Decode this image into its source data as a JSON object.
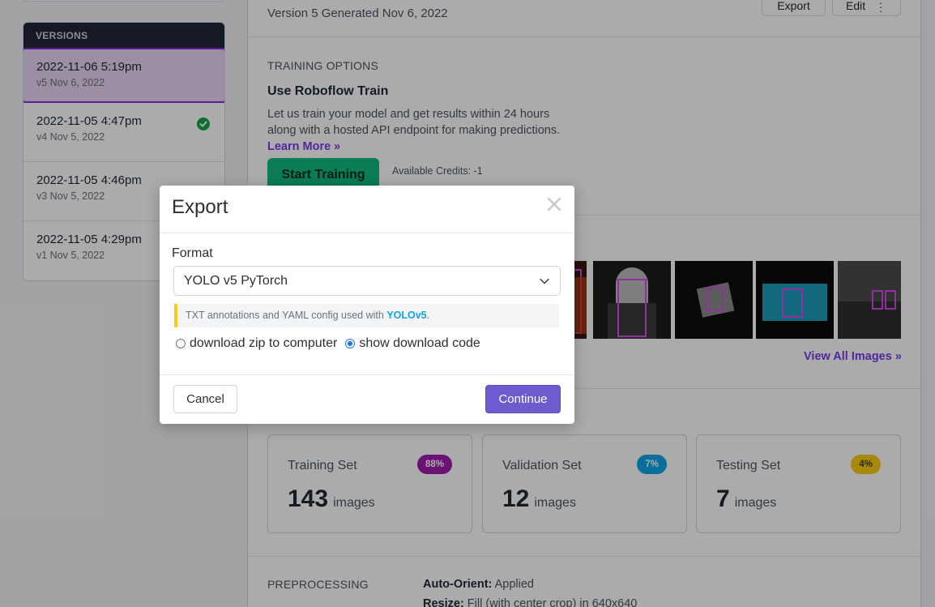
{
  "header": {
    "version_generated": "Version 5 Generated Nov 6, 2022",
    "export_label": "Export",
    "edit_label": "Edit"
  },
  "sidebar": {
    "title": "VERSIONS",
    "items": [
      {
        "title": "2022-11-06 5:19pm",
        "sub": "v5 Nov 6, 2022",
        "active": true
      },
      {
        "title": "2022-11-05 4:47pm",
        "sub": "v4 Nov 5, 2022",
        "status": "check-icon"
      },
      {
        "title": "2022-11-05 4:46pm",
        "sub": "v3 Nov 5, 2022"
      },
      {
        "title": "2022-11-05 4:29pm",
        "sub": "v1 Nov 5, 2022"
      }
    ]
  },
  "training": {
    "section_label": "TRAINING OPTIONS",
    "title": "Use Roboflow Train",
    "description": "Let us train your model and get results within 24 hours along with a hosted API endpoint for making predictions.",
    "learn_more": "Learn More »",
    "start_label": "Start Training",
    "credits": "Available Credits: -1"
  },
  "images": {
    "view_all": "View All Images »"
  },
  "splits": [
    {
      "name": "Training Set",
      "percent": "88%",
      "count": "143",
      "unit": "images",
      "badge_bg": "#a21caf",
      "badge_fg": "#ffffff"
    },
    {
      "name": "Validation Set",
      "percent": "7%",
      "count": "12",
      "unit": "images",
      "badge_bg": "#0ea5e9",
      "badge_fg": "#ffffff"
    },
    {
      "name": "Testing Set",
      "percent": "4%",
      "count": "7",
      "unit": "images",
      "badge_bg": "#facc15",
      "badge_fg": "#3f3f1a"
    }
  ],
  "preprocessing": {
    "section_label": "PREPROCESSING",
    "rows": [
      {
        "key": "Auto-Orient:",
        "value": " Applied"
      },
      {
        "key": "Resize:",
        "value": " Fill (with center crop) in 640x640"
      }
    ]
  },
  "modal": {
    "title": "Export",
    "format_label": "Format",
    "format_value": "YOLO v5 PyTorch",
    "hint_text": "TXT annotations and YAML config used with ",
    "hint_link": "YOLOv5",
    "hint_end": ".",
    "options": [
      {
        "label": "download zip to computer",
        "checked": false
      },
      {
        "label": "show download code",
        "checked": true
      }
    ],
    "cancel_label": "Cancel",
    "continue_label": "Continue"
  },
  "colors": {
    "accent": "#6d5bd0",
    "brand_purple": "#7c3aed",
    "train_green": "#10b981"
  }
}
